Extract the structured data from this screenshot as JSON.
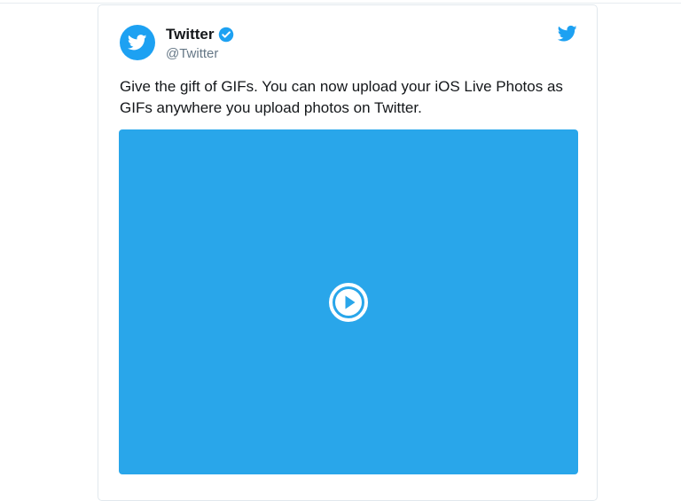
{
  "tweet": {
    "display_name": "Twitter",
    "handle": "@Twitter",
    "verified": true,
    "text": "Give the gift of GIFs. You can now upload your iOS Live Photos as GIFs anywhere you upload photos on Twitter.",
    "media": {
      "type": "video",
      "background_color": "#29a6ea"
    }
  },
  "icons": {
    "avatar": "twitter-bird-icon",
    "verified": "verified-badge-icon",
    "corner": "twitter-bird-icon",
    "media": "play-icon"
  },
  "colors": {
    "brand": "#1da1f2",
    "text": "#14171a",
    "secondary_text": "#657786",
    "media_background": "#29a6ea"
  }
}
